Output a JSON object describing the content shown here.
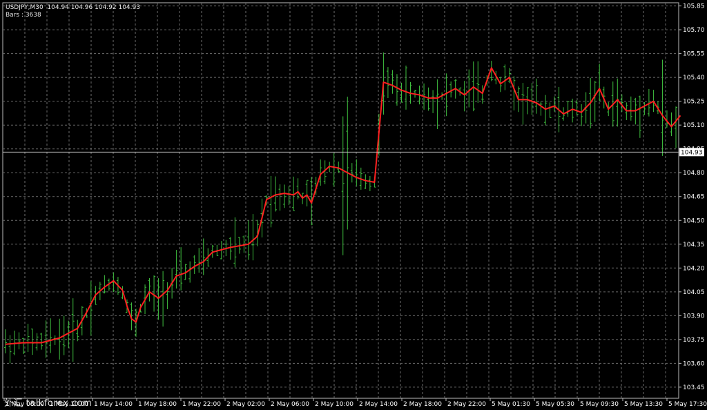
{
  "header": {
    "info": "USDJPY,M30  104.94 104.96 104.92 104.93",
    "bars": "Bars : 3638"
  },
  "current_price_label": "104.93",
  "watermark": "外汇 talkforex.com",
  "colors": {
    "background": "#000000",
    "grid": "#6b6b6b",
    "bars": "#3fbf3f",
    "ma": "#ff2020",
    "price_line": "#c8c8c8"
  },
  "chart_data": {
    "type": "line",
    "title": "USDJPY,M30",
    "ylim": [
      103.35,
      105.9
    ],
    "y_ticks": [
      "105.85",
      "105.70",
      "105.55",
      "105.40",
      "105.25",
      "105.10",
      "104.95",
      "104.80",
      "104.65",
      "104.50",
      "104.35",
      "104.20",
      "104.05",
      "103.90",
      "103.75",
      "103.60",
      "103.45"
    ],
    "x_ticks": [
      "1 May 06:00",
      "1 May 10:00",
      "1 May 14:00",
      "1 May 18:00",
      "1 May 22:00",
      "2 May 02:00",
      "2 May 06:00",
      "2 May 10:00",
      "2 May 14:00",
      "2 May 18:00",
      "2 May 22:00",
      "5 May 01:30",
      "5 May 05:30",
      "5 May 09:30",
      "5 May 13:30",
      "5 May 17:30"
    ],
    "grid": true,
    "current_price": 104.93,
    "ma_series": {
      "name": "",
      "x": [
        0,
        4,
        8,
        12,
        16,
        18,
        20,
        22,
        24,
        26,
        27,
        28,
        29,
        30,
        32,
        34,
        36,
        38,
        40,
        42,
        44,
        46,
        50,
        54,
        56,
        58,
        60,
        62,
        64,
        65,
        66,
        67,
        68,
        70,
        72,
        74,
        76,
        78,
        80,
        82,
        84,
        86,
        88,
        90,
        92,
        94,
        96,
        98,
        100,
        102,
        104,
        106,
        108,
        110,
        112,
        114,
        116,
        118,
        120,
        122,
        124,
        126,
        128,
        130,
        132,
        134,
        136,
        138,
        140,
        142,
        144,
        146,
        148,
        150
      ],
      "y": [
        103.72,
        103.73,
        103.73,
        103.76,
        103.82,
        103.92,
        104.03,
        104.08,
        104.12,
        104.06,
        103.96,
        103.88,
        103.86,
        103.95,
        104.05,
        104.01,
        104.06,
        104.15,
        104.17,
        104.21,
        104.24,
        104.3,
        104.33,
        104.35,
        104.4,
        104.63,
        104.66,
        104.67,
        104.66,
        104.68,
        104.64,
        104.66,
        104.61,
        104.79,
        104.84,
        104.83,
        104.8,
        104.77,
        104.75,
        104.74,
        105.37,
        105.35,
        105.32,
        105.3,
        105.29,
        105.27,
        105.27,
        105.3,
        105.33,
        105.29,
        105.34,
        105.3,
        105.46,
        105.36,
        105.4,
        105.26,
        105.26,
        105.24,
        105.2,
        105.22,
        105.17,
        105.2,
        105.18,
        105.24,
        105.33,
        105.2,
        105.26,
        105.19,
        105.19,
        105.22,
        105.25,
        105.16,
        105.09,
        105.16
      ]
    },
    "price_bars": {
      "count": 150,
      "low": [
        103.7,
        103.69,
        103.67,
        103.65,
        103.66,
        103.58,
        103.72,
        103.8,
        103.88,
        103.92,
        103.95,
        103.98,
        104.0,
        104.02,
        104.05,
        104.05,
        103.95,
        103.8,
        103.75,
        103.9,
        104.0,
        104.02,
        104.08,
        104.12,
        104.25,
        104.3,
        104.32,
        104.38,
        104.4,
        104.45,
        104.5,
        104.4,
        104.44,
        104.6,
        104.62,
        104.65,
        104.63,
        104.6,
        104.62,
        104.6,
        104.7,
        104.65,
        104.62,
        104.66,
        104.64,
        104.62,
        104.6,
        104.62,
        105.0,
        105.2,
        105.22,
        105.18,
        105.1,
        105.15,
        105.12,
        105.1,
        105.18,
        105.16,
        105.2,
        105.22,
        105.2,
        105.18,
        105.15,
        105.08,
        105.05
      ]
    }
  }
}
